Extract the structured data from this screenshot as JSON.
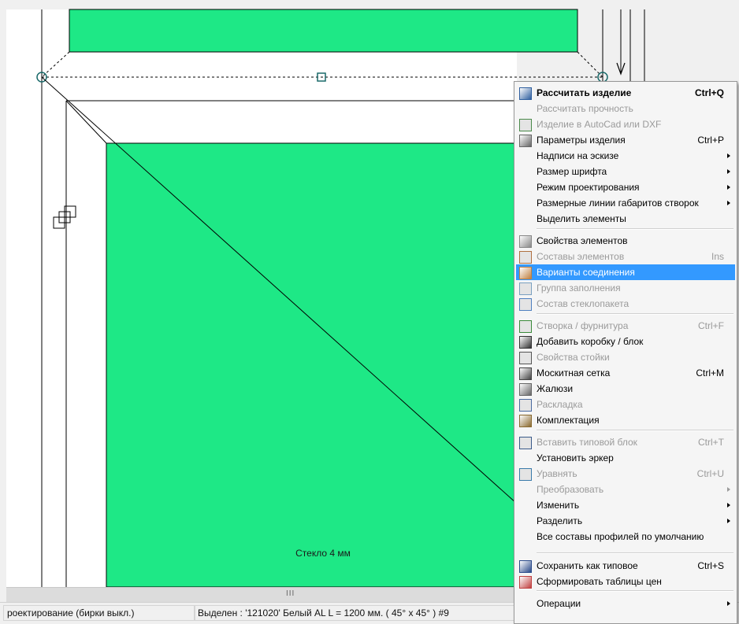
{
  "drawing": {
    "glass_label": "Стекло 4 мм",
    "colors": {
      "glass": "#1ee886",
      "frame_line": "#000000",
      "handle": "#1a6a6a"
    }
  },
  "scrollbar": {
    "grip": "III"
  },
  "statusbar": {
    "mode": "роектирование  (бирки выкл.)",
    "selection": "Выделен : '121020' Белый AL    L = 1200 мм. ( 45° x 45° )  #9"
  },
  "menu": {
    "items": [
      {
        "label": "Рассчитать изделие",
        "shortcut": "Ctrl+Q",
        "icon": "calculator-icon",
        "enabled": true,
        "bold": true
      },
      {
        "label": "Рассчитать прочность",
        "shortcut": "",
        "icon": "",
        "enabled": false
      },
      {
        "label": "Изделие в AutoCad или DXF",
        "shortcut": "",
        "icon": "autocad-icon",
        "enabled": false
      },
      {
        "label": "Параметры изделия",
        "shortcut": "Ctrl+P",
        "icon": "parameters-icon",
        "enabled": true
      },
      {
        "label": "Надписи на эскизе",
        "shortcut": "",
        "icon": "",
        "enabled": true,
        "submenu": true
      },
      {
        "label": "Размер шрифта",
        "shortcut": "",
        "icon": "",
        "enabled": true,
        "submenu": true
      },
      {
        "label": "Режим проектирования",
        "shortcut": "",
        "icon": "",
        "enabled": true,
        "submenu": true
      },
      {
        "label": "Размерные линии габаритов створок",
        "shortcut": "",
        "icon": "",
        "enabled": true,
        "submenu": true
      },
      {
        "label": "Выделить элементы",
        "shortcut": "",
        "icon": "",
        "enabled": true
      },
      {
        "label": "Свойства элементов",
        "shortcut": "",
        "icon": "properties-icon",
        "enabled": true
      },
      {
        "label": "Составы элементов",
        "shortcut": "Ins",
        "icon": "compositions-icon",
        "enabled": false
      },
      {
        "label": "Варианты соединения",
        "shortcut": "",
        "icon": "connection-icon",
        "enabled": true,
        "highlighted": true
      },
      {
        "label": "Группа заполнения",
        "shortcut": "",
        "icon": "fill-group-icon",
        "enabled": false
      },
      {
        "label": "Состав стеклопакета",
        "shortcut": "",
        "icon": "glass-unit-icon",
        "enabled": false
      },
      {
        "label": "Створка  /  фурнитура",
        "shortcut": "Ctrl+F",
        "icon": "sash-icon",
        "enabled": false
      },
      {
        "label": "Добавить коробку / блок",
        "shortcut": "",
        "icon": "add-frame-icon",
        "enabled": true
      },
      {
        "label": "Свойства стойки",
        "shortcut": "",
        "icon": "mullion-icon",
        "enabled": false
      },
      {
        "label": "Москитная  сетка",
        "shortcut": "Ctrl+M",
        "icon": "mosquito-net-icon",
        "enabled": true
      },
      {
        "label": "Жалюзи",
        "shortcut": "",
        "icon": "blinds-icon",
        "enabled": true
      },
      {
        "label": "Раскладка",
        "shortcut": "",
        "icon": "layout-icon",
        "enabled": false
      },
      {
        "label": "Комплектация",
        "shortcut": "",
        "icon": "equipment-icon",
        "enabled": true
      },
      {
        "label": "Вставить типовой блок",
        "shortcut": "Ctrl+T",
        "icon": "insert-block-icon",
        "enabled": false
      },
      {
        "label": "Установить эркер",
        "shortcut": "",
        "icon": "",
        "enabled": true
      },
      {
        "label": "Уравнять",
        "shortcut": "Ctrl+U",
        "icon": "equalize-icon",
        "enabled": false
      },
      {
        "label": "Преобразовать",
        "shortcut": "",
        "icon": "",
        "enabled": false,
        "submenu": true
      },
      {
        "label": "Изменить",
        "shortcut": "",
        "icon": "",
        "enabled": true,
        "submenu": true
      },
      {
        "label": "Разделить",
        "shortcut": "",
        "icon": "",
        "enabled": true,
        "submenu": true
      },
      {
        "label": "Все составы профилей по умолчанию",
        "shortcut": "",
        "icon": "",
        "enabled": true
      },
      {
        "label": "Сохранить как типовое",
        "shortcut": "Ctrl+S",
        "icon": "save-template-icon",
        "enabled": true
      },
      {
        "label": "Сформировать таблицы цен",
        "shortcut": "",
        "icon": "price-table-icon",
        "enabled": true
      },
      {
        "label": "Операции",
        "shortcut": "",
        "icon": "",
        "enabled": true,
        "submenu": true
      }
    ]
  }
}
